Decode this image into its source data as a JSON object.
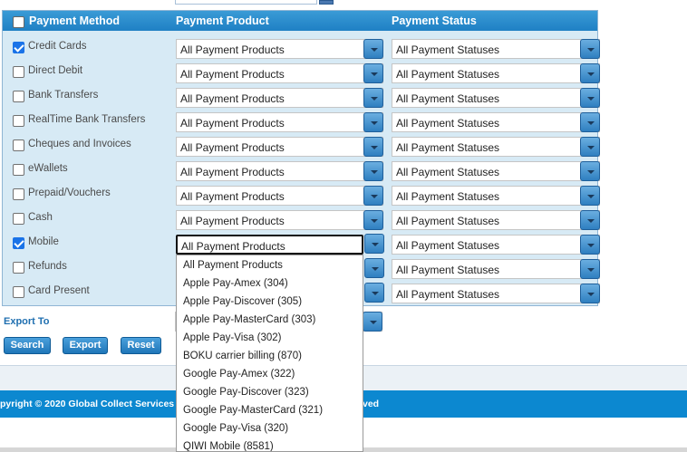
{
  "header": {
    "col_method": "Payment Method",
    "col_product": "Payment Product",
    "col_status": "Payment Status"
  },
  "rows": [
    {
      "label": "Credit Cards",
      "checked": true,
      "product": "All Payment Products",
      "status": "All Payment Statuses"
    },
    {
      "label": "Direct Debit",
      "checked": false,
      "product": "All Payment Products",
      "status": "All Payment Statuses"
    },
    {
      "label": "Bank Transfers",
      "checked": false,
      "product": "All Payment Products",
      "status": "All Payment Statuses"
    },
    {
      "label": "RealTime Bank Transfers",
      "checked": false,
      "product": "All Payment Products",
      "status": "All Payment Statuses"
    },
    {
      "label": "Cheques and Invoices",
      "checked": false,
      "product": "All Payment Products",
      "status": "All Payment Statuses"
    },
    {
      "label": "eWallets",
      "checked": false,
      "product": "All Payment Products",
      "status": "All Payment Statuses"
    },
    {
      "label": "Prepaid/Vouchers",
      "checked": false,
      "product": "All Payment Products",
      "status": "All Payment Statuses"
    },
    {
      "label": "Cash",
      "checked": false,
      "product": "All Payment Products",
      "status": "All Payment Statuses"
    },
    {
      "label": "Mobile",
      "checked": true,
      "product": "All Payment Products",
      "status": "All Payment Statuses"
    },
    {
      "label": "Refunds",
      "checked": false,
      "product": "",
      "status": "All Payment Statuses"
    },
    {
      "label": "Card Present",
      "checked": false,
      "product": "",
      "status": "All Payment Statuses"
    }
  ],
  "export": {
    "label": "Export To"
  },
  "buttons": {
    "search": "Search",
    "export": "Export",
    "reset": "Reset"
  },
  "footer": {
    "left": "pyright © 2020 Global Collect Services",
    "right": "ved"
  },
  "dropdown_options": [
    "All Payment Products",
    "Apple Pay-Amex (304)",
    "Apple Pay-Discover (305)",
    "Apple Pay-MasterCard (303)",
    "Apple Pay-Visa (302)",
    "BOKU carrier billing (870)",
    "Google Pay-Amex (322)",
    "Google Pay-Discover (323)",
    "Google Pay-MasterCard (321)",
    "Google Pay-Visa (320)",
    "QIWI Mobile (8581)"
  ],
  "colors": {
    "header": "#1f80c4",
    "panel": "#d7eaf5",
    "footer": "#0c88d0",
    "accent": "#1a73e8"
  }
}
